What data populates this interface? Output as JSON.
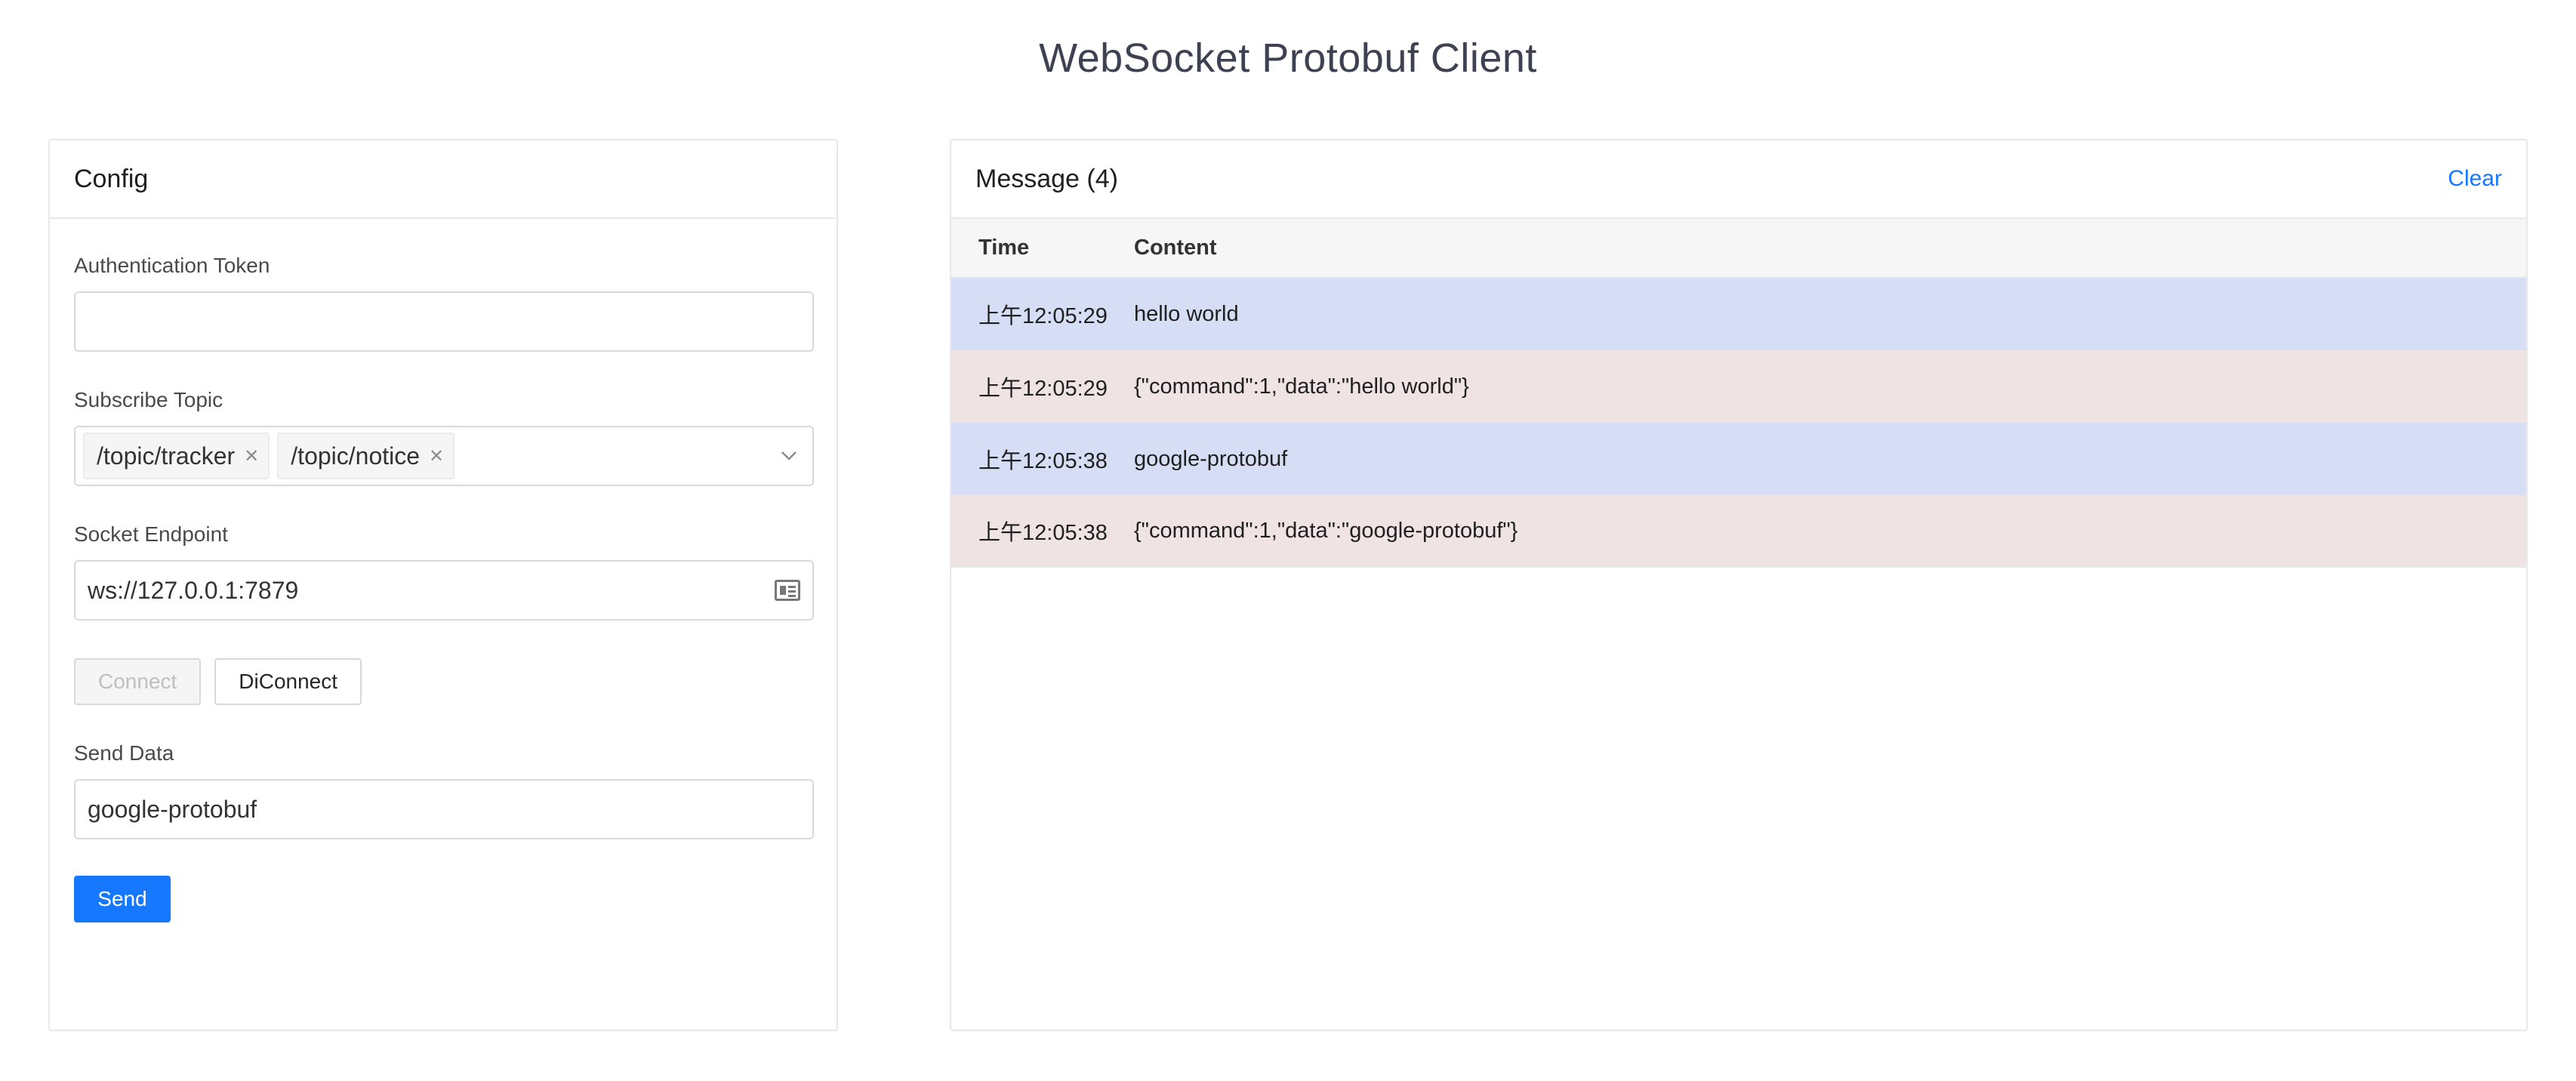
{
  "page": {
    "title": "WebSocket Protobuf Client"
  },
  "config": {
    "title": "Config",
    "auth_label": "Authentication Token",
    "auth_value": "",
    "topic_label": "Subscribe Topic",
    "topics": [
      "/topic/tracker",
      "/topic/notice"
    ],
    "endpoint_label": "Socket Endpoint",
    "endpoint_value": "ws://127.0.0.1:7879",
    "connect_label": "Connect",
    "disconnect_label": "DiConnect",
    "send_label_field": "Send Data",
    "send_value": "google-protobuf",
    "send_button": "Send"
  },
  "messages": {
    "title": "Message (4)",
    "clear_label": "Clear",
    "columns": [
      "Time",
      "Content"
    ],
    "rows": [
      {
        "time": "上午12:05:29",
        "content": "hello world",
        "kind": "blue"
      },
      {
        "time": "上午12:05:29",
        "content": "{\"command\":1,\"data\":\"hello world\"}",
        "kind": "pink"
      },
      {
        "time": "上午12:05:38",
        "content": "google-protobuf",
        "kind": "blue"
      },
      {
        "time": "上午12:05:38",
        "content": "{\"command\":1,\"data\":\"google-protobuf\"}",
        "kind": "pink"
      }
    ]
  },
  "colors": {
    "primary": "#1677ff",
    "row_blue": "#d6def5",
    "row_pink": "#efe3e4"
  }
}
